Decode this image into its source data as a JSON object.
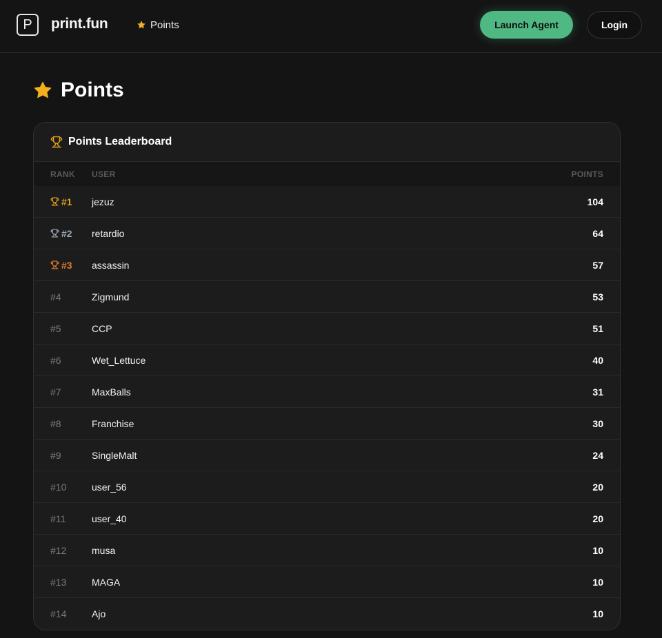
{
  "header": {
    "logo_letter": "P",
    "brand": "print.fun",
    "nav_points_label": "Points",
    "launch_label": "Launch Agent",
    "login_label": "Login"
  },
  "page": {
    "title": "Points"
  },
  "leaderboard": {
    "title": "Points Leaderboard",
    "columns": {
      "rank": "RANK",
      "user": "USER",
      "points": "POINTS"
    },
    "rows": [
      {
        "rank": "#1",
        "user": "jezuz",
        "points": "104",
        "trophy_color": "#e3a21a"
      },
      {
        "rank": "#2",
        "user": "retardio",
        "points": "64",
        "trophy_color": "#9aa6b3"
      },
      {
        "rank": "#3",
        "user": "assassin",
        "points": "57",
        "trophy_color": "#e07a2e"
      },
      {
        "rank": "#4",
        "user": "Zigmund",
        "points": "53"
      },
      {
        "rank": "#5",
        "user": "CCP",
        "points": "51"
      },
      {
        "rank": "#6",
        "user": "Wet_Lettuce",
        "points": "40"
      },
      {
        "rank": "#7",
        "user": "MaxBalls",
        "points": "31"
      },
      {
        "rank": "#8",
        "user": "Franchise",
        "points": "30"
      },
      {
        "rank": "#9",
        "user": "SingleMalt",
        "points": "24"
      },
      {
        "rank": "#10",
        "user": "user_56",
        "points": "20"
      },
      {
        "rank": "#11",
        "user": "user_40",
        "points": "20"
      },
      {
        "rank": "#12",
        "user": "musa",
        "points": "10"
      },
      {
        "rank": "#13",
        "user": "MAGA",
        "points": "10"
      },
      {
        "rank": "#14",
        "user": "Ajo",
        "points": "10"
      }
    ]
  },
  "colors": {
    "accent_green": "#4fb883",
    "star_yellow": "#f2b01e",
    "gold": "#e3a21a",
    "silver": "#9aa6b3",
    "bronze": "#e07a2e"
  },
  "icons": {
    "nav": "star-icon",
    "title": "star-icon",
    "card": "trophy-icon",
    "rank": "trophy-icon"
  }
}
